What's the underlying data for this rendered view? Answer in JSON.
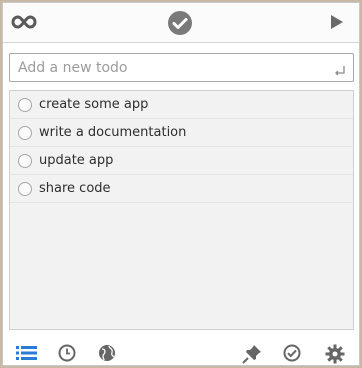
{
  "header": {
    "left_icon": "infinity-icon",
    "center_icon": "checkmark-logo-icon",
    "right_icon": "play-icon"
  },
  "new_todo": {
    "placeholder": "Add a new todo",
    "value": "",
    "submit_icon": "enter-return-icon"
  },
  "todos": [
    {
      "label": "create some app",
      "done": false
    },
    {
      "label": "write a documentation",
      "done": false
    },
    {
      "label": "update app",
      "done": false
    },
    {
      "label": "share code",
      "done": false
    }
  ],
  "footer": {
    "icons": [
      "list-icon",
      "clock-icon",
      "globe-icon",
      "pin-icon",
      "check-circle-icon",
      "gear-icon"
    ]
  },
  "colors": {
    "accent_blue": "#2a7bd6",
    "icon_gray": "#6b6b6b",
    "list_bg": "#f2f2f2"
  }
}
